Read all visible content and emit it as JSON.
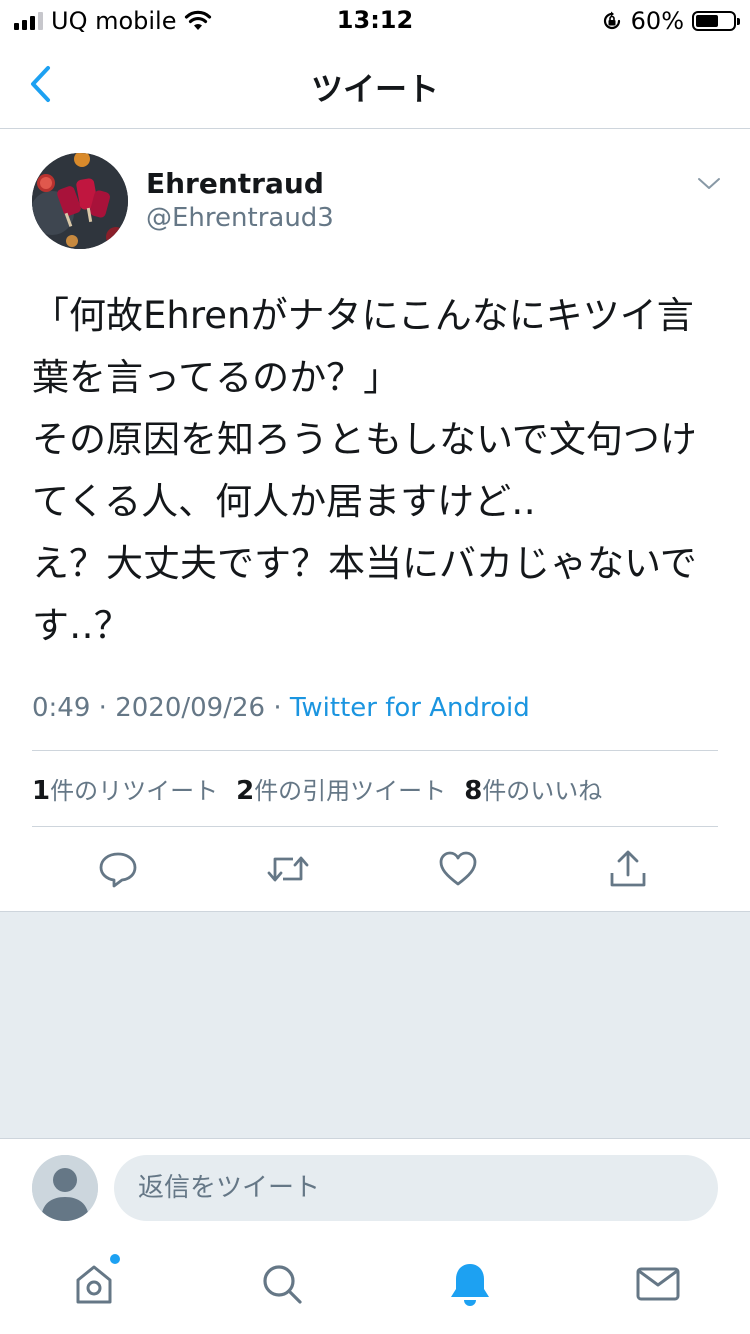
{
  "status_bar": {
    "carrier": "UQ mobile",
    "time": "13:12",
    "battery_percent": "60%"
  },
  "nav": {
    "title": "ツイート"
  },
  "tweet": {
    "author_name": "Ehrentraud",
    "author_handle": "@Ehrentraud3",
    "text": "「何故Ehrenがナタにこんなにキツイ言葉を言ってるのか？」\nその原因を知ろうともしないで文句つけてくる人、何人か居ますけど‥\nえ？大丈夫です？本当にバカじゃないです‥？",
    "time": "0:49",
    "date": "2020/09/26",
    "source": "Twitter for Android",
    "stats": {
      "retweets_count": "1",
      "retweets_label": "件のリツイート",
      "quotes_count": "2",
      "quotes_label": "件の引用ツイート",
      "likes_count": "8",
      "likes_label": "件のいいね"
    }
  },
  "reply": {
    "placeholder": "返信をツイート"
  },
  "tabs": [
    "home-icon",
    "search-icon",
    "notifications-icon",
    "messages-icon"
  ],
  "colors": {
    "accent": "#1da1f2",
    "link": "#1b95e0",
    "muted": "#657786",
    "text": "#14171a",
    "background_gray": "#e6ecf0"
  }
}
